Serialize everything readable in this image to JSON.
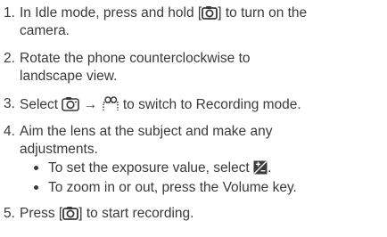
{
  "steps": [
    {
      "number": "1.",
      "text_before": "In Idle mode, press and hold [",
      "icon": "camera-key-icon",
      "text_after": "] to turn on the",
      "line2": "camera."
    },
    {
      "number": "2.",
      "line1": "Rotate the phone counterclockwise to",
      "line2": "landscape view."
    },
    {
      "number": "3.",
      "text_before": "Select",
      "icon1": "camera-mode-icon",
      "arrow": "→",
      "icon2": "video-mode-icon",
      "text_after": "to switch to Recording mode."
    },
    {
      "number": "4.",
      "line1": "Aim the lens at the subject and make any",
      "line2": "adjustments.",
      "bullets": [
        {
          "text": "To set the exposure value, select",
          "icon": "exposure-value-icon",
          "suffix": "."
        },
        {
          "text": "To zoom in or out, press the Volume key."
        }
      ]
    },
    {
      "number": "5.",
      "text_before": "Press [",
      "icon": "camera-key-icon",
      "text_after": "] to start recording."
    }
  ]
}
